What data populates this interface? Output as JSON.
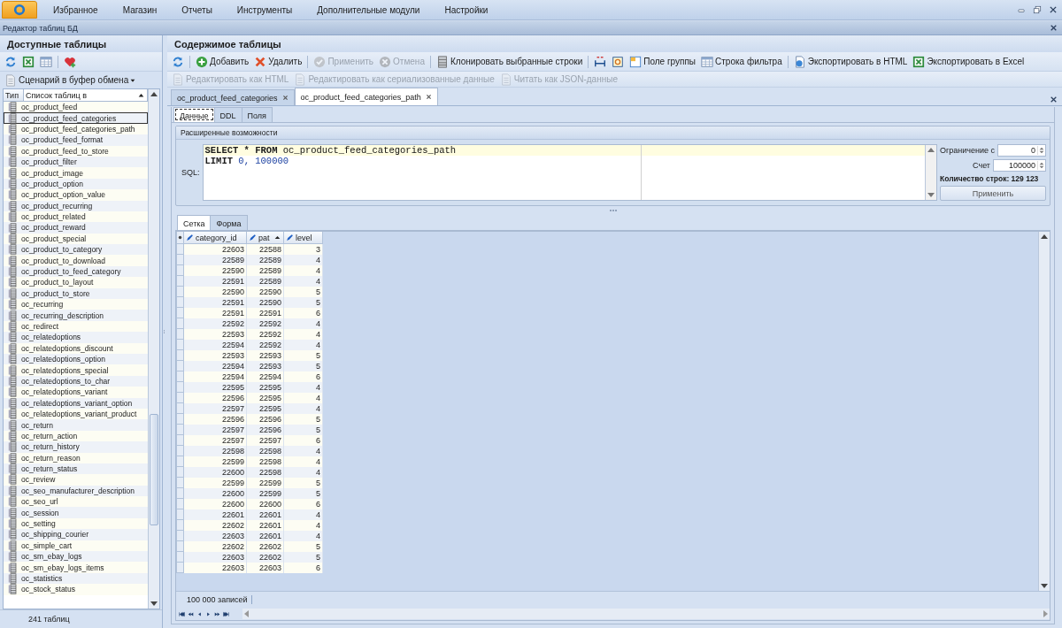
{
  "menu_bar": {
    "items": [
      "Избранное",
      "Магазин",
      "Отчеты",
      "Инструменты",
      "Дополнительные модули",
      "Настройки"
    ]
  },
  "document_title": "Редактор таблиц БД",
  "left_panel": {
    "title": "Доступные таблицы",
    "toolbar": [
      {
        "kind": "refresh"
      },
      {
        "kind": "excel"
      },
      {
        "kind": "table"
      },
      {
        "kind": "separator"
      },
      {
        "kind": "heart"
      }
    ],
    "script_button": "Сценарий в буфер обмена",
    "list_columns": [
      "Тип",
      "Список таблиц в"
    ],
    "tables": [
      {
        "name": "oc_product_feed",
        "selected": false
      },
      {
        "name": "oc_product_feed_categories",
        "selected": true
      },
      {
        "name": "oc_product_feed_categories_path",
        "selected": false
      },
      {
        "name": "oc_product_feed_format",
        "selected": false
      },
      {
        "name": "oc_product_feed_to_store",
        "selected": false
      },
      {
        "name": "oc_product_filter",
        "selected": false
      },
      {
        "name": "oc_product_image",
        "selected": false
      },
      {
        "name": "oc_product_option",
        "selected": false
      },
      {
        "name": "oc_product_option_value",
        "selected": false
      },
      {
        "name": "oc_product_recurring",
        "selected": false
      },
      {
        "name": "oc_product_related",
        "selected": false
      },
      {
        "name": "oc_product_reward",
        "selected": false
      },
      {
        "name": "oc_product_special",
        "selected": false
      },
      {
        "name": "oc_product_to_category",
        "selected": false
      },
      {
        "name": "oc_product_to_download",
        "selected": false
      },
      {
        "name": "oc_product_to_feed_category",
        "selected": false
      },
      {
        "name": "oc_product_to_layout",
        "selected": false
      },
      {
        "name": "oc_product_to_store",
        "selected": false
      },
      {
        "name": "oc_recurring",
        "selected": false
      },
      {
        "name": "oc_recurring_description",
        "selected": false
      },
      {
        "name": "oc_redirect",
        "selected": false
      },
      {
        "name": "oc_relatedoptions",
        "selected": false
      },
      {
        "name": "oc_relatedoptions_discount",
        "selected": false
      },
      {
        "name": "oc_relatedoptions_option",
        "selected": false
      },
      {
        "name": "oc_relatedoptions_special",
        "selected": false
      },
      {
        "name": "oc_relatedoptions_to_char",
        "selected": false
      },
      {
        "name": "oc_relatedoptions_variant",
        "selected": false
      },
      {
        "name": "oc_relatedoptions_variant_option",
        "selected": false
      },
      {
        "name": "oc_relatedoptions_variant_product",
        "selected": false
      },
      {
        "name": "oc_return",
        "selected": false
      },
      {
        "name": "oc_return_action",
        "selected": false
      },
      {
        "name": "oc_return_history",
        "selected": false
      },
      {
        "name": "oc_return_reason",
        "selected": false
      },
      {
        "name": "oc_return_status",
        "selected": false
      },
      {
        "name": "oc_review",
        "selected": false
      },
      {
        "name": "oc_seo_manufacturer_description",
        "selected": false
      },
      {
        "name": "oc_seo_url",
        "selected": false
      },
      {
        "name": "oc_session",
        "selected": false
      },
      {
        "name": "oc_setting",
        "selected": false
      },
      {
        "name": "oc_shipping_courier",
        "selected": false
      },
      {
        "name": "oc_simple_cart",
        "selected": false
      },
      {
        "name": "oc_sm_ebay_logs",
        "selected": false
      },
      {
        "name": "oc_sm_ebay_logs_items",
        "selected": false
      },
      {
        "name": "oc_statistics",
        "selected": false
      },
      {
        "name": "oc_stock_status",
        "selected": false
      }
    ],
    "footer": "241 таблиц"
  },
  "right_panel": {
    "title": "Содержимое таблицы",
    "toolbar_1": [
      {
        "kind": "refresh",
        "disabled": false
      },
      {
        "kind": "separator"
      },
      {
        "kind": "plus",
        "label": "Добавить",
        "disabled": false
      },
      {
        "kind": "cross",
        "label": "Удалить",
        "disabled": false
      },
      {
        "kind": "separator"
      },
      {
        "kind": "check",
        "label": "Применить",
        "disabled": true
      },
      {
        "kind": "cancel",
        "label": "Отмена",
        "disabled": true
      },
      {
        "kind": "separator"
      },
      {
        "kind": "clone",
        "label": "Клонировать выбранные строки",
        "disabled": false
      },
      {
        "kind": "separator"
      },
      {
        "kind": "columns",
        "disabled": false
      },
      {
        "kind": "fit",
        "disabled": false
      },
      {
        "kind": "group",
        "label": "Поле группы",
        "disabled": false
      },
      {
        "kind": "filter",
        "label": "Строка фильтра",
        "disabled": false
      },
      {
        "kind": "separator"
      },
      {
        "kind": "html",
        "label": "Экспортировать в HTML",
        "disabled": false
      },
      {
        "kind": "excel",
        "label": "Экспортировать в Excel",
        "disabled": false
      }
    ],
    "toolbar_2": [
      {
        "kind": "doc",
        "label": "Редактировать как HTML",
        "disabled": true
      },
      {
        "kind": "doc",
        "label": "Редактировать как сериализованные данные",
        "disabled": true
      },
      {
        "kind": "doc",
        "label": "Читать как JSON-данные",
        "disabled": true
      }
    ],
    "document_tabs": [
      {
        "label": "oc_product_feed_categories",
        "selected": false
      },
      {
        "label": "oc_product_feed_categories_path",
        "selected": true
      }
    ],
    "view_tabs": [
      {
        "label": "Данные",
        "selected": true
      },
      {
        "label": "DDL",
        "selected": false
      },
      {
        "label": "Поля",
        "selected": false
      }
    ],
    "query_group": {
      "title": "Расширенные возможности",
      "sql_label": "SQL:",
      "sql_lines": [
        [
          {
            "kind": "keyword",
            "text": "SELECT * FROM"
          },
          {
            "kind": "identifier",
            "text": "oc_product_feed_categories_path"
          }
        ],
        [
          {
            "kind": "keyword",
            "text": "LIMIT"
          },
          {
            "kind": "number",
            "text": "0,"
          },
          {
            "kind": "number",
            "text": "100000"
          }
        ]
      ],
      "offset_label": "Ограничение с",
      "offset_value": "0",
      "count_label": "Счет",
      "count_value": "100000",
      "row_count": "Количество строк: 129 123",
      "apply_button": "Применить"
    },
    "result_tabs": [
      {
        "label": "Сетка",
        "selected": true
      },
      {
        "label": "Форма",
        "selected": false
      }
    ],
    "grid": {
      "columns": [
        {
          "label": "category_id",
          "sorted": false
        },
        {
          "label": "pat",
          "sorted": true
        },
        {
          "label": "level",
          "sorted": false
        }
      ],
      "rows": [
        [
          "22603",
          "22588",
          "3"
        ],
        [
          "22589",
          "22589",
          "4"
        ],
        [
          "22590",
          "22589",
          "4"
        ],
        [
          "22591",
          "22589",
          "4"
        ],
        [
          "22590",
          "22590",
          "5"
        ],
        [
          "22591",
          "22590",
          "5"
        ],
        [
          "22591",
          "22591",
          "6"
        ],
        [
          "22592",
          "22592",
          "4"
        ],
        [
          "22593",
          "22592",
          "4"
        ],
        [
          "22594",
          "22592",
          "4"
        ],
        [
          "22593",
          "22593",
          "5"
        ],
        [
          "22594",
          "22593",
          "5"
        ],
        [
          "22594",
          "22594",
          "6"
        ],
        [
          "22595",
          "22595",
          "4"
        ],
        [
          "22596",
          "22595",
          "4"
        ],
        [
          "22597",
          "22595",
          "4"
        ],
        [
          "22596",
          "22596",
          "5"
        ],
        [
          "22597",
          "22596",
          "5"
        ],
        [
          "22597",
          "22597",
          "6"
        ],
        [
          "22598",
          "22598",
          "4"
        ],
        [
          "22599",
          "22598",
          "4"
        ],
        [
          "22600",
          "22598",
          "4"
        ],
        [
          "22599",
          "22599",
          "5"
        ],
        [
          "22600",
          "22599",
          "5"
        ],
        [
          "22600",
          "22600",
          "6"
        ],
        [
          "22601",
          "22601",
          "4"
        ],
        [
          "22602",
          "22601",
          "4"
        ],
        [
          "22603",
          "22601",
          "4"
        ],
        [
          "22602",
          "22602",
          "5"
        ],
        [
          "22603",
          "22602",
          "5"
        ],
        [
          "22603",
          "22603",
          "6"
        ]
      ],
      "footer": "100 000 записей"
    }
  }
}
